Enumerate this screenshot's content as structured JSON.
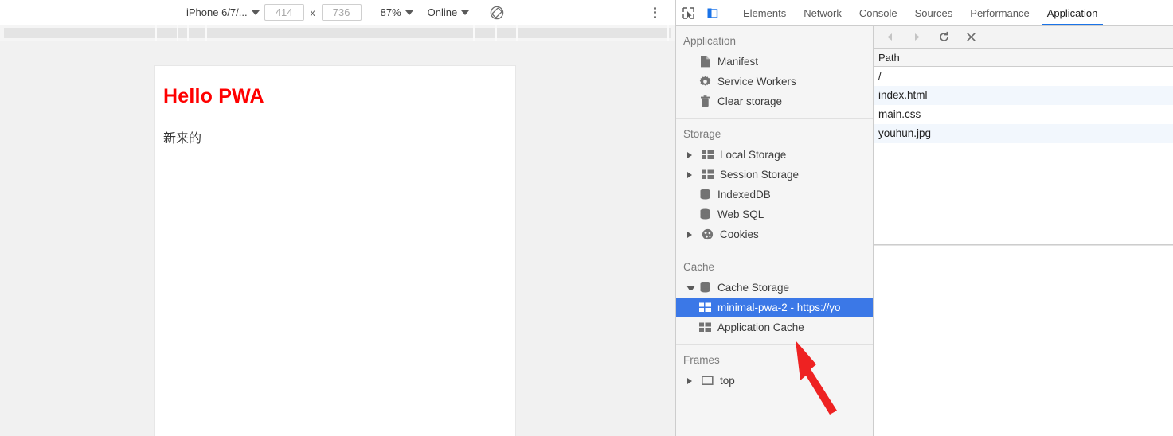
{
  "device_toolbar": {
    "device_name": "iPhone 6/7/...",
    "width_value": "414",
    "height_value": "736",
    "dimension_separator": "x",
    "zoom_value": "87%",
    "network_value": "Online",
    "rotate_icon": "rotate-device-icon",
    "menu_icon": "more-options-icon"
  },
  "viewport": {
    "heading": "Hello PWA",
    "body_text": "新来的",
    "heading_color": "#ff0000"
  },
  "devtools": {
    "inspect_icon": "inspect-element-icon",
    "device_toggle_icon": "toggle-device-toolbar-icon",
    "tabs": [
      {
        "label": "Elements",
        "active": false
      },
      {
        "label": "Network",
        "active": false
      },
      {
        "label": "Console",
        "active": false
      },
      {
        "label": "Sources",
        "active": false
      },
      {
        "label": "Performance",
        "active": false
      },
      {
        "label": "Application",
        "active": true
      }
    ],
    "accent_color": "#1a73e8"
  },
  "sidebar": {
    "sections": [
      {
        "title": "Application",
        "items": [
          {
            "label": "Manifest",
            "icon": "manifest-document-icon",
            "arrow": "none",
            "selected": false,
            "indent": 2
          },
          {
            "label": "Service Workers",
            "icon": "service-workers-gear-icon",
            "arrow": "none",
            "selected": false,
            "indent": 2
          },
          {
            "label": "Clear storage",
            "icon": "clear-storage-trash-icon",
            "arrow": "none",
            "selected": false,
            "indent": 2
          }
        ]
      },
      {
        "title": "Storage",
        "items": [
          {
            "label": "Local Storage",
            "icon": "table-grid-icon",
            "arrow": "closed",
            "selected": false,
            "indent": 1
          },
          {
            "label": "Session Storage",
            "icon": "table-grid-icon",
            "arrow": "closed",
            "selected": false,
            "indent": 1
          },
          {
            "label": "IndexedDB",
            "icon": "database-icon",
            "arrow": "none",
            "selected": false,
            "indent": 2
          },
          {
            "label": "Web SQL",
            "icon": "database-icon",
            "arrow": "none",
            "selected": false,
            "indent": 2
          },
          {
            "label": "Cookies",
            "icon": "cookie-icon",
            "arrow": "closed",
            "selected": false,
            "indent": 1
          }
        ]
      },
      {
        "title": "Cache",
        "items": [
          {
            "label": "Cache Storage",
            "icon": "database-icon",
            "arrow": "open",
            "selected": false,
            "indent": 1
          },
          {
            "label": "minimal-pwa-2 - https://yo",
            "icon": "table-grid-icon",
            "arrow": "none",
            "selected": true,
            "indent": 2
          },
          {
            "label": "Application Cache",
            "icon": "table-grid-icon",
            "arrow": "none",
            "selected": false,
            "indent": 2
          }
        ]
      },
      {
        "title": "Frames",
        "items": [
          {
            "label": "top",
            "icon": "frame-rectangle-icon",
            "arrow": "closed",
            "selected": false,
            "indent": 1
          }
        ]
      }
    ],
    "selection_color": "#3b78e7"
  },
  "cache_panel": {
    "toolbar_buttons": [
      {
        "name": "previous-page-button",
        "icon": "triangle-left-icon",
        "disabled": true
      },
      {
        "name": "next-page-button",
        "icon": "triangle-right-icon",
        "disabled": true
      },
      {
        "name": "refresh-button",
        "icon": "refresh-icon",
        "disabled": false
      },
      {
        "name": "delete-entry-button",
        "icon": "close-x-icon",
        "disabled": false
      }
    ],
    "column_header": "Path",
    "rows": [
      {
        "path": "/"
      },
      {
        "path": "index.html"
      },
      {
        "path": "main.css"
      },
      {
        "path": "youhun.jpg"
      }
    ]
  },
  "annotation": {
    "arrow_color": "#ee2222",
    "name": "red-pointer-arrow"
  }
}
